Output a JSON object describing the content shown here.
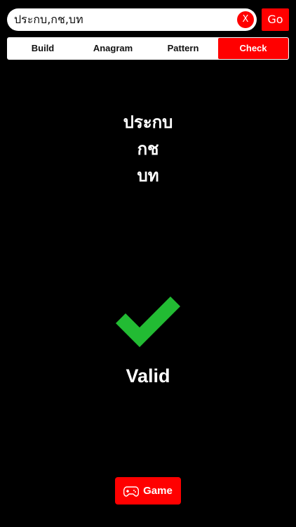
{
  "search": {
    "value": "ประกบ,กช,บท",
    "clear_label": "X",
    "go_label": "Go"
  },
  "tabs": [
    {
      "label": "Build",
      "active": false
    },
    {
      "label": "Anagram",
      "active": false
    },
    {
      "label": "Pattern",
      "active": false
    },
    {
      "label": "Check",
      "active": true
    }
  ],
  "words": [
    "ประกบ",
    "กช",
    "บท"
  ],
  "result": {
    "label": "Valid",
    "icon": "checkmark-icon",
    "color": "#22bb33"
  },
  "game_button": {
    "label": "Game",
    "icon": "gamepad-icon"
  },
  "colors": {
    "accent": "#ff0000",
    "background": "#000000",
    "valid": "#22bb33"
  }
}
